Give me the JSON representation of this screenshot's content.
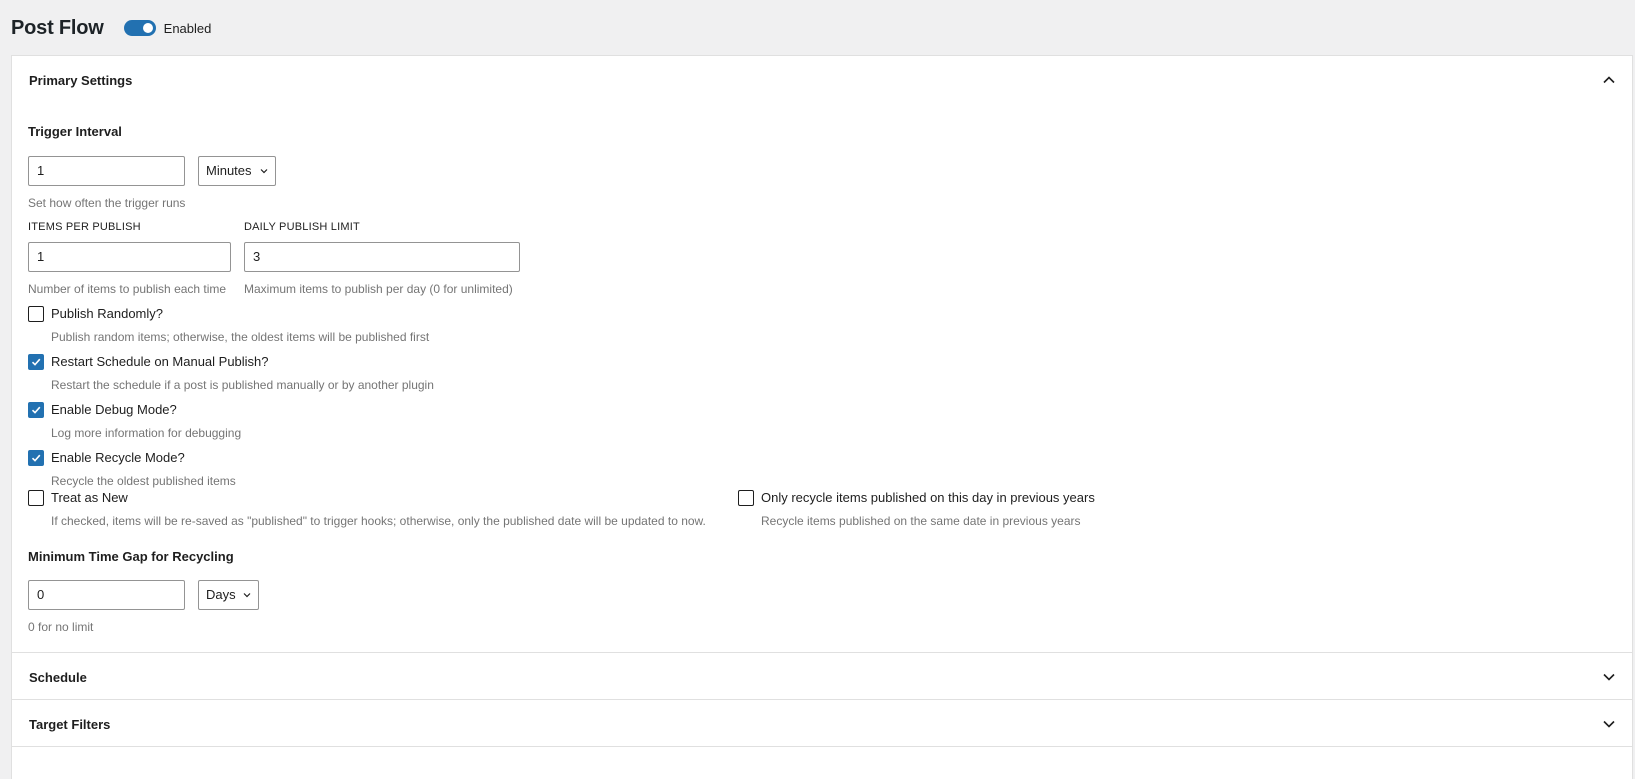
{
  "header": {
    "title": "Post Flow",
    "toggle_label": "Enabled",
    "toggle_on": true
  },
  "sections": {
    "primary": {
      "title": "Primary Settings",
      "expanded": true
    },
    "schedule": {
      "title": "Schedule",
      "expanded": false
    },
    "target_filters": {
      "title": "Target Filters",
      "expanded": false
    }
  },
  "trigger_interval": {
    "label": "Trigger Interval",
    "value": "1",
    "unit": "Minutes",
    "help": "Set how often the trigger runs"
  },
  "items_per_publish": {
    "label": "ITEMS PER PUBLISH",
    "value": "1",
    "help": "Number of items to publish each time"
  },
  "daily_publish_limit": {
    "label": "DAILY PUBLISH LIMIT",
    "value": "3",
    "help": "Maximum items to publish per day (0 for unlimited)"
  },
  "options": {
    "publish_randomly": {
      "label": "Publish Randomly?",
      "checked": false,
      "help": "Publish random items; otherwise, the oldest items will be published first"
    },
    "restart_schedule": {
      "label": "Restart Schedule on Manual Publish?",
      "checked": true,
      "help": "Restart the schedule if a post is published manually or by another plugin"
    },
    "debug_mode": {
      "label": "Enable Debug Mode?",
      "checked": true,
      "help": "Log more information for debugging"
    },
    "recycle_mode": {
      "label": "Enable Recycle Mode?",
      "checked": true,
      "help": "Recycle the oldest published items"
    },
    "treat_as_new": {
      "label": "Treat as New",
      "checked": false,
      "help": "If checked, items will be re-saved as \"published\" to trigger hooks; otherwise, only the published date will be updated to now."
    },
    "only_this_day": {
      "label": "Only recycle items published on this day in previous years",
      "checked": false,
      "help": "Recycle items published on the same date in previous years"
    }
  },
  "min_gap": {
    "label": "Minimum Time Gap for Recycling",
    "value": "0",
    "unit": "Days",
    "help": "0 for no limit"
  },
  "colors": {
    "accent": "#2271b1",
    "background": "#f0f0f1",
    "help_text": "#757575"
  }
}
